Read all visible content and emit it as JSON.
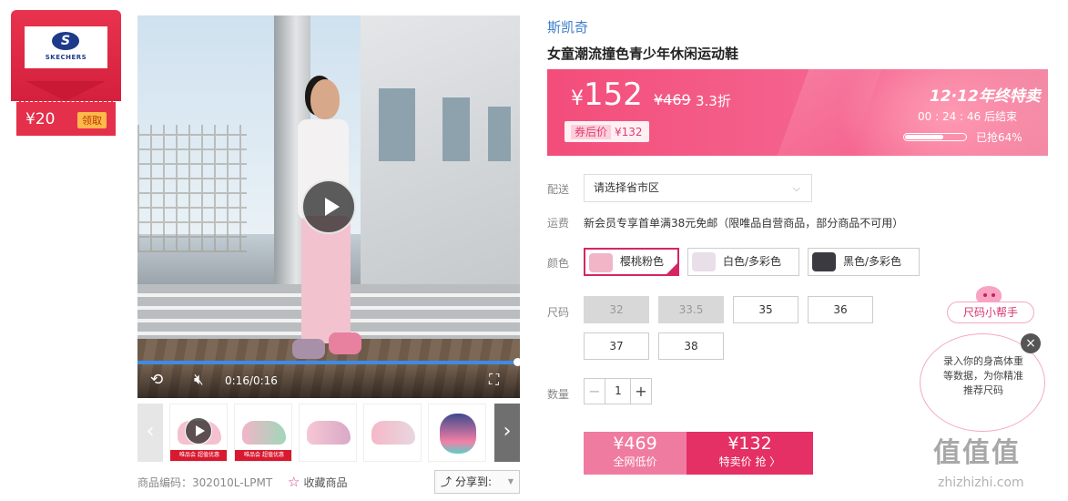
{
  "coupon": {
    "amount": "¥20",
    "get_label": "领取",
    "logo_text": "SKECHERS",
    "logo_letter": "S"
  },
  "video": {
    "time": "0:16/0:16",
    "progress": 1.0
  },
  "thumbnails": {
    "tag_text": "唯品会 超值优惠"
  },
  "product_code": "商品编码：302010L-LPMT",
  "favorite_label": "收藏商品",
  "share_label": "分享到:",
  "brand": "斯凯奇",
  "title": "女童潮流撞色青少年休闲运动鞋",
  "price": {
    "currency": "¥",
    "current": "152",
    "original": "¥469",
    "discount": "3.3折",
    "coupon_label": "券后价",
    "coupon_price": "¥132"
  },
  "promo": {
    "title": "12·12年终特卖",
    "countdown": "00 : 24 : 46  后结束",
    "sold_pct": 0.64,
    "sold_text": "已抢64%"
  },
  "delivery": {
    "label": "配送",
    "placeholder": "请选择省市区"
  },
  "shipping": {
    "label": "运费",
    "text": "新会员专享首单满38元免邮（限唯品自营商品，部分商品不可用）"
  },
  "colors": {
    "label": "颜色",
    "options": [
      {
        "name": "樱桃粉色",
        "selected": true,
        "swatch": "#f2b5c8"
      },
      {
        "name": "白色/多彩色",
        "selected": false,
        "swatch": "#e9dfe8"
      },
      {
        "name": "黑色/多彩色",
        "selected": false,
        "swatch": "#3a3a40"
      }
    ]
  },
  "sizes": {
    "label": "尺码",
    "options": [
      {
        "v": "32",
        "disabled": true
      },
      {
        "v": "33.5",
        "disabled": true
      },
      {
        "v": "35",
        "disabled": false
      },
      {
        "v": "36",
        "disabled": false
      },
      {
        "v": "37",
        "disabled": false
      },
      {
        "v": "38",
        "disabled": false
      }
    ]
  },
  "quantity": {
    "label": "数量",
    "value": "1",
    "minus": "−",
    "plus": "+"
  },
  "buy": {
    "normal_price": "¥469",
    "normal_label": "全网低价",
    "special_price": "¥132",
    "special_label": "特卖价 抢 〉"
  },
  "size_helper": {
    "title": "尺码小帮手",
    "text": "录入你的身高体重等数据，为你精准推荐尺码",
    "close": "×"
  },
  "watermark": {
    "main": "值值值",
    "sub": "zhizhizhi.com"
  },
  "colors_theme": {
    "accent": "#e43064",
    "brand_blue": "#3e7dc9"
  }
}
